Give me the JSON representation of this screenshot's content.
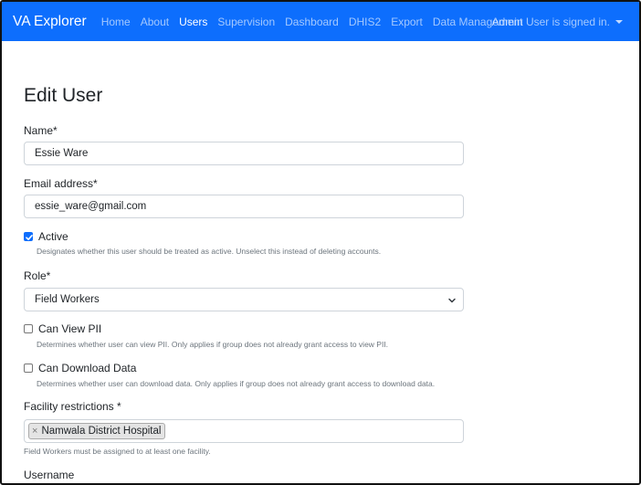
{
  "navbar": {
    "brand": "VA Explorer",
    "links": [
      {
        "label": "Home",
        "active": false
      },
      {
        "label": "About",
        "active": false
      },
      {
        "label": "Users",
        "active": true
      },
      {
        "label": "Supervision",
        "active": false
      },
      {
        "label": "Dashboard",
        "active": false
      },
      {
        "label": "DHIS2",
        "active": false
      },
      {
        "label": "Export",
        "active": false
      },
      {
        "label": "Data Management",
        "active": false
      }
    ],
    "user_status": "Admin User is signed in."
  },
  "form": {
    "title": "Edit User",
    "name": {
      "label": "Name*",
      "value": "Essie Ware"
    },
    "email": {
      "label": "Email address*",
      "value": "essie_ware@gmail.com"
    },
    "active": {
      "label": "Active",
      "checked": true,
      "help": "Designates whether this user should be treated as active. Unselect this instead of deleting accounts."
    },
    "role": {
      "label": "Role*",
      "selected": "Field Workers"
    },
    "can_view_pii": {
      "label": "Can View PII",
      "checked": false,
      "help": "Determines whether user can view PII. Only applies if group does not already grant access to view PII."
    },
    "can_download": {
      "label": "Can Download Data",
      "checked": false,
      "help": "Determines whether user can download data. Only applies if group does not already grant access to download data."
    },
    "facility": {
      "label": "Facility restrictions *",
      "tags": [
        "Namwala District Hospital"
      ],
      "remove_glyph": "×",
      "help": "Field Workers must be assigned to at least one facility."
    },
    "username": {
      "label": "Username"
    }
  },
  "colors": {
    "navbar": "#0d6efd",
    "accent": "#0d6efd"
  }
}
